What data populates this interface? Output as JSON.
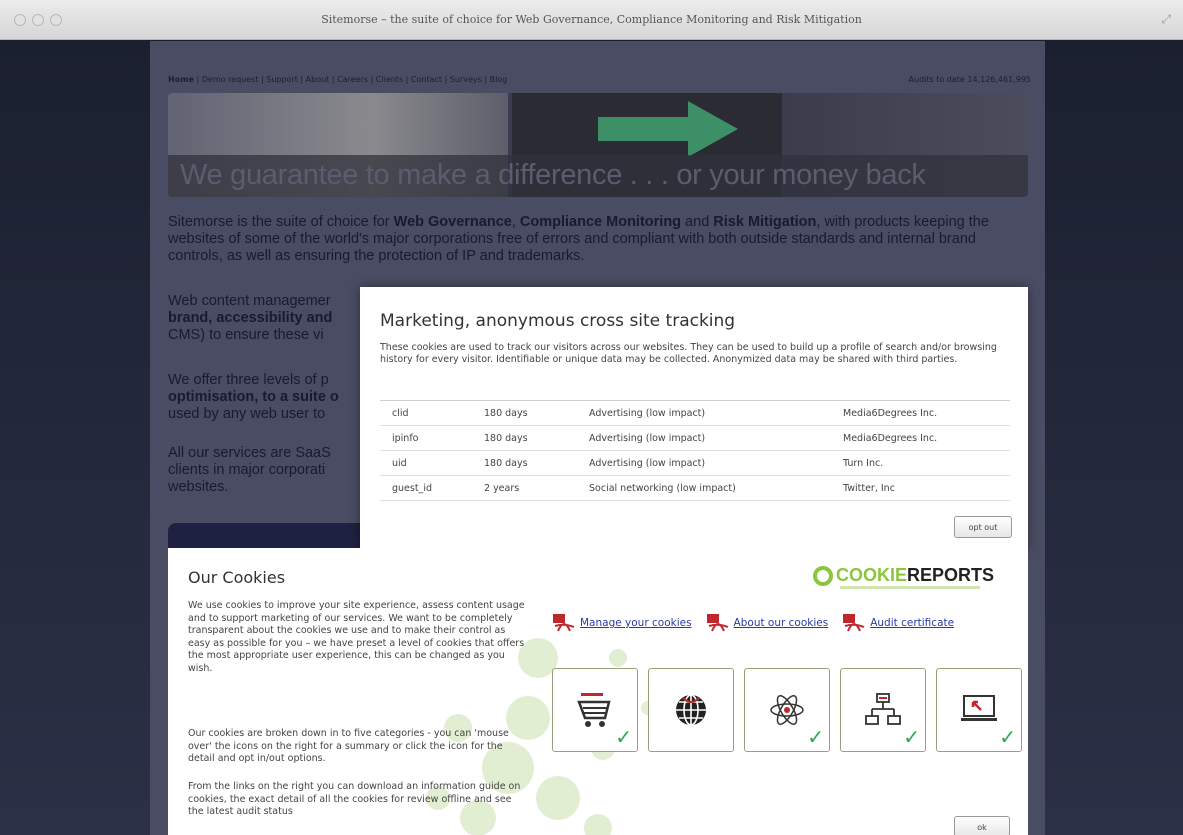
{
  "window": {
    "title": "Sitemorse – the suite of choice for Web Governance, Compliance Monitoring and Risk Mitigation"
  },
  "site": {
    "nav": [
      "Home",
      "Demo request",
      "Support",
      "About",
      "Careers",
      "Clients",
      "Contact",
      "Surveys",
      "Blog"
    ],
    "audit_counter": "Audits to date 14,126,461,995",
    "slogan": "We guarantee to make a difference . . . or your money back",
    "intro": {
      "t1": "Sitemorse is the suite of choice for ",
      "b1": "Web Governance",
      "t2": ", ",
      "b2": "Compliance Monitoring",
      "t3": " and ",
      "b3": "Risk Mitigation",
      "t4": ", with products keeping the websites of some of the world's major corporations free of errors and compliant with both outside standards and internal brand controls, as well as ensuring the protection of IP and trademarks."
    },
    "para2_lines": [
      "Web content managemer",
      "brand, accessibility and",
      "CMS) to ensure these vi"
    ],
    "para3_lines": [
      "We offer three levels of p",
      "optimisation, to a suite o",
      "used by any web user to"
    ],
    "para4_lines": [
      "All our services are SaaS",
      "clients in major corporati",
      "websites."
    ]
  },
  "marketing_popup": {
    "title": "Marketing, anonymous cross site tracking",
    "description": "These cookies are used to track our visitors across our websites. They can be used to build up a profile of search and/or browsing history for every visitor. Identifiable or unique data may be collected. Anonymized data may be shared with third parties.",
    "rows": [
      {
        "name": "clid",
        "expiry": "180 days",
        "category": "Advertising (low impact)",
        "provider": "Media6Degrees Inc."
      },
      {
        "name": "ipinfo",
        "expiry": "180 days",
        "category": "Advertising (low impact)",
        "provider": "Media6Degrees Inc."
      },
      {
        "name": "uid",
        "expiry": "180 days",
        "category": "Advertising (low impact)",
        "provider": "Turn Inc."
      },
      {
        "name": "guest_id",
        "expiry": "2 years",
        "category": "Social networking (low impact)",
        "provider": "Twitter, Inc"
      }
    ],
    "opt_out_label": "opt out"
  },
  "cookies_panel": {
    "title": "Our Cookies",
    "p1": "We use cookies to improve your site experience, assess content usage and to support marketing of our services. We want to be completely transparent about the cookies we use and to make their control as easy as possible for you – we have preset a level of cookies that offers the most appropriate user experience, this can be changed as you wish.",
    "p2": "Our cookies are broken down in to five categories - you can 'mouse over' the icons on the right for a summary or click the icon for the detail and opt in/out options.",
    "p3": "From the links on the right you can download an information guide on cookies, the exact detail of all the cookies for review offline and see the latest audit status",
    "logo_a": "COOKIE",
    "logo_b": "REPORTS",
    "links": {
      "manage": "Manage your cookies",
      "about": "About our cookies",
      "audit": "Audit certificate"
    },
    "ok_label": "ok",
    "brand_green": "#8cc63f",
    "check_color": "#27a84a"
  }
}
